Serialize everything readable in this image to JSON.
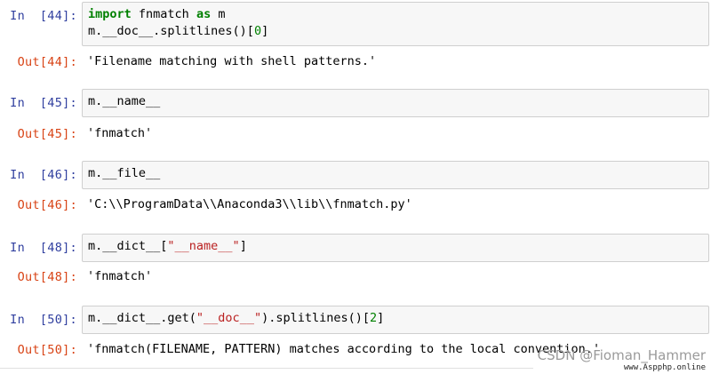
{
  "cells": [
    {
      "in_prompt": "In  [44]:",
      "code": {
        "l1_kw1": "import",
        "l1_mid": " fnmatch ",
        "l1_kw2": "as",
        "l1_end": " m",
        "l2_pre": "m.__doc__.splitlines()[",
        "l2_num": "0",
        "l2_post": "]"
      },
      "out_prompt": "Out[44]:",
      "output": "'Filename matching with shell patterns.'"
    },
    {
      "in_prompt": "In  [45]:",
      "code": {
        "l1": "m.__name__"
      },
      "out_prompt": "Out[45]:",
      "output": "'fnmatch'"
    },
    {
      "in_prompt": "In  [46]:",
      "code": {
        "l1": "m.__file__"
      },
      "out_prompt": "Out[46]:",
      "output": "'C:\\\\ProgramData\\\\Anaconda3\\\\lib\\\\fnmatch.py'"
    },
    {
      "in_prompt": "In  [48]:",
      "code": {
        "l1_pre": "m.__dict__[",
        "l1_str": "\"__name__\"",
        "l1_post": "]"
      },
      "out_prompt": "Out[48]:",
      "output": "'fnmatch'"
    },
    {
      "in_prompt": "In  [50]:",
      "code": {
        "l1_pre": "m.__dict__.get(",
        "l1_str": "\"__doc__\"",
        "l1_mid": ").splitlines()[",
        "l1_num": "2",
        "l1_post": "]"
      },
      "out_prompt": "Out[50]:",
      "output": "'fnmatch(FILENAME, PATTERN) matches according to the local convention.'"
    }
  ],
  "watermark": {
    "csdn": "CSDN @Fioman_Hammer",
    "site": "www.Aspphp.online"
  }
}
